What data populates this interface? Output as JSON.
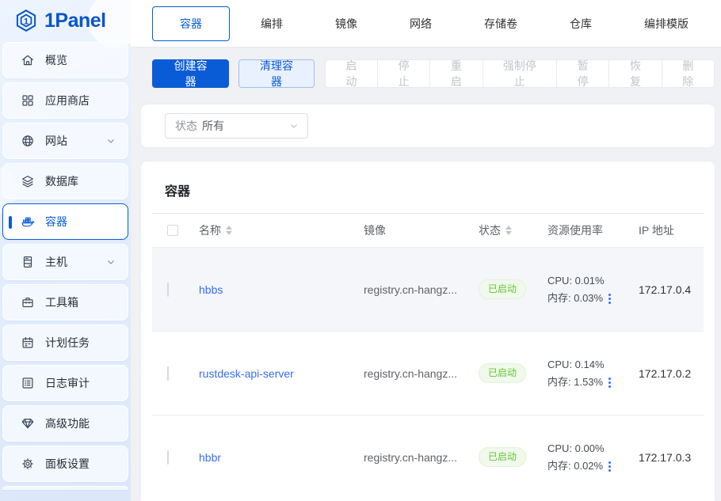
{
  "brand": {
    "name": "1Panel",
    "logo_glyph": "1"
  },
  "sidebar": {
    "items": [
      {
        "label": "概览",
        "icon": "home-icon"
      },
      {
        "label": "应用商店",
        "icon": "app-store-icon"
      },
      {
        "label": "网站",
        "icon": "globe-icon",
        "expandable": true
      },
      {
        "label": "数据库",
        "icon": "database-icon"
      },
      {
        "label": "容器",
        "icon": "docker-icon",
        "active": true
      },
      {
        "label": "主机",
        "icon": "host-icon",
        "expandable": true
      },
      {
        "label": "工具箱",
        "icon": "toolbox-icon"
      },
      {
        "label": "计划任务",
        "icon": "calendar-icon"
      },
      {
        "label": "日志审计",
        "icon": "log-icon"
      },
      {
        "label": "高级功能",
        "icon": "diamond-icon"
      },
      {
        "label": "面板设置",
        "icon": "gear-icon"
      }
    ]
  },
  "tabs": [
    {
      "label": "容器",
      "active": true
    },
    {
      "label": "编排"
    },
    {
      "label": "镜像"
    },
    {
      "label": "网络"
    },
    {
      "label": "存储卷"
    },
    {
      "label": "仓库"
    },
    {
      "label": "编排模版"
    }
  ],
  "toolbar": {
    "create_label": "创建容器",
    "clean_label": "清理容器",
    "batch_buttons": [
      "启动",
      "停止",
      "重启",
      "强制停止",
      "暂停",
      "恢复",
      "删除"
    ]
  },
  "filter": {
    "label": "状态",
    "value": "所有"
  },
  "table": {
    "title": "容器",
    "columns": {
      "name": "名称",
      "image": "镜像",
      "status": "状态",
      "resource": "资源使用率",
      "ip": "IP 地址"
    },
    "rows": [
      {
        "name": "hbbs",
        "image": "registry.cn-hangz...",
        "status": "已启动",
        "cpu": "CPU: 0.01%",
        "memory": "内存: 0.03%",
        "ip": "172.17.0.4"
      },
      {
        "name": "rustdesk-api-server",
        "image": "registry.cn-hangz...",
        "status": "已启动",
        "cpu": "CPU: 0.14%",
        "memory": "内存: 1.53%",
        "ip": "172.17.0.2"
      },
      {
        "name": "hbbr",
        "image": "registry.cn-hangz...",
        "status": "已启动",
        "cpu": "CPU: 0.00%",
        "memory": "内存: 0.02%",
        "ip": "172.17.0.3"
      }
    ]
  },
  "colors": {
    "primary": "#0a5cd6",
    "link": "#366ef4",
    "success_text": "#67c23a",
    "success_bg": "#f0f9eb",
    "success_border": "#e1f3d8",
    "sidebar_bg": "#e3edfc",
    "content_bg": "#eff1f4"
  }
}
